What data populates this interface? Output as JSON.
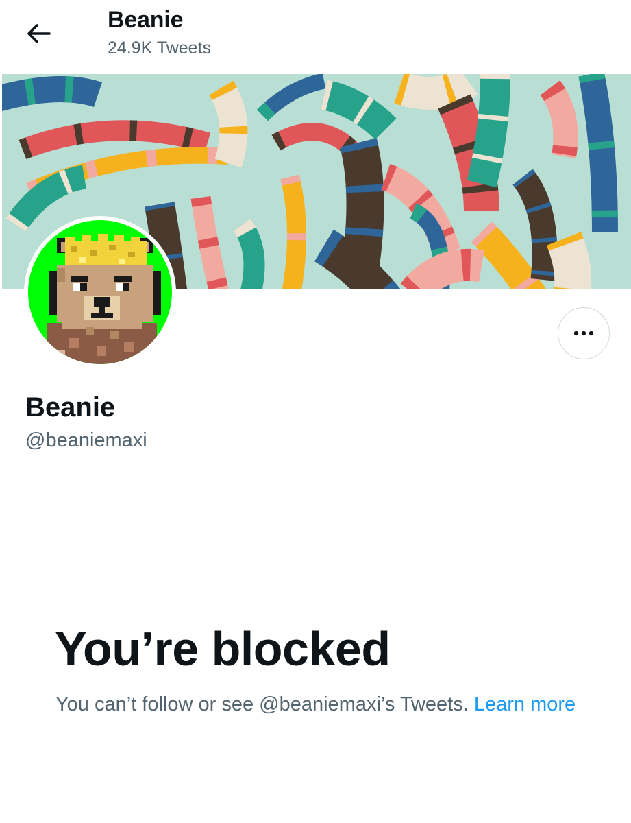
{
  "header": {
    "name": "Beanie",
    "tweet_count": "24.9K Tweets",
    "back_icon": "back-arrow-icon"
  },
  "profile": {
    "display_name": "Beanie",
    "handle": "@beaniemaxi",
    "avatar_icon": "pixel-bear-avatar",
    "avatar_bg_color": "#00ff04",
    "more_icon": "more-dots-icon"
  },
  "banner": {
    "bg_color": "#b9ded4",
    "palette": [
      "#2f6699",
      "#e15759",
      "#f6b21c",
      "#27a38b",
      "#4a3a2e",
      "#f1a9a0",
      "#ece3d3"
    ]
  },
  "blocked": {
    "heading": "You’re blocked",
    "message": "You can’t follow or see @beaniemaxi’s Tweets.",
    "link_label": "Learn more"
  },
  "colors": {
    "primary_text": "#0f1419",
    "secondary_text": "#536471",
    "link": "#1d9bf0",
    "border": "#cfd9de"
  }
}
